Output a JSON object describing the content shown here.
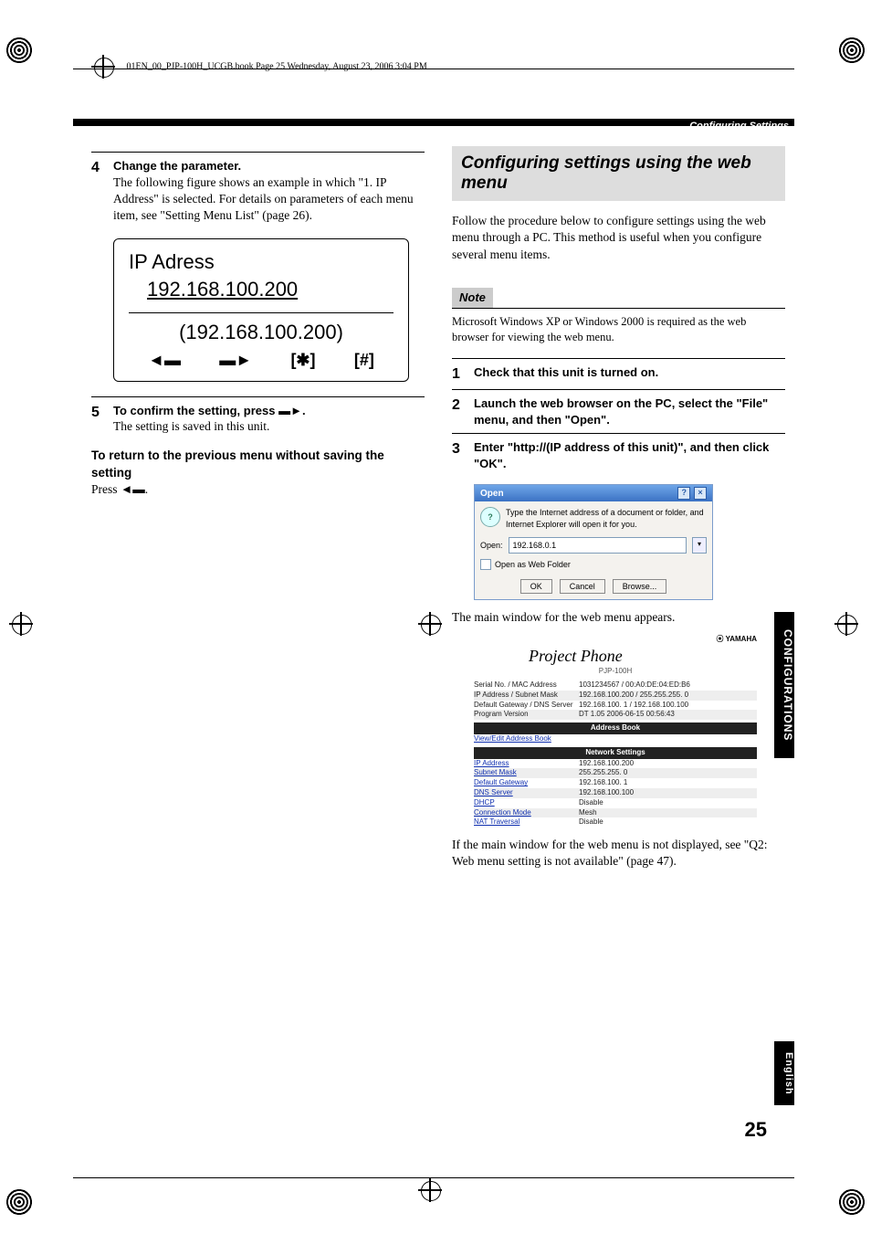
{
  "running_header": "01EN_00_PJP-100H_UCGB.book  Page 25  Wednesday, August 23, 2006  3:04 PM",
  "chapter": "Configuring Settings",
  "left": {
    "step4": {
      "num": "4",
      "title": "Change the parameter.",
      "text": "The following figure shows an example in which \"1. IP Address\" is selected. For details on parameters of each menu item, see \"Setting Menu List\" (page 26).",
      "lcd": {
        "line1": "IP Adress",
        "line2": "192.168.100.200",
        "line3": "(192.168.100.200)",
        "icons": [
          "◄▬",
          "▬►",
          "[✱]",
          "[#]"
        ]
      }
    },
    "step5": {
      "num": "5",
      "title_pre": "To confirm the setting, press ",
      "icon": "▬►",
      "title_post": ".",
      "text": "The setting is saved in this unit."
    },
    "sub1": {
      "heading": "To return to the previous menu without saving the setting",
      "text_pre": "Press ",
      "icon": "◄▬",
      "text_post": "."
    }
  },
  "right": {
    "heading": "Configuring settings using the web menu",
    "intro": "Follow the procedure below to configure settings using the web menu through a PC. This method is useful when you configure several menu items.",
    "note_label": "Note",
    "note_text": "Microsoft Windows XP or Windows 2000 is required as the web browser for viewing the web menu.",
    "step1": {
      "num": "1",
      "title": "Check that this unit is turned on."
    },
    "step2": {
      "num": "2",
      "title": "Launch the web browser on the PC, select the \"File\" menu, and then \"Open\"."
    },
    "step3": {
      "num": "3",
      "title": "Enter \"http://(IP address of this unit)\", and then click \"OK\"."
    },
    "dialog": {
      "title": "Open",
      "help_icon": "?",
      "close_icon": "×",
      "msg": "Type the Internet address of a document or folder, and Internet Explorer will open it for you.",
      "open_label": "Open:",
      "input_value": "192.168.0.1",
      "checkbox_label": "Open as Web Folder",
      "ok": "OK",
      "cancel": "Cancel",
      "browse": "Browse..."
    },
    "after_dialog": "The main window for the web menu appears.",
    "webmenu": {
      "brand": "YAMAHA",
      "logo": "Project Phone",
      "model": "PJP-100H",
      "info": [
        {
          "k": "Serial No. / MAC Address",
          "v": "1031234567 / 00:A0:DE:04:ED:B6"
        },
        {
          "k": "IP Address / Subnet Mask",
          "v": "192.168.100.200 / 255.255.255. 0"
        },
        {
          "k": "Default Gateway / DNS Server",
          "v": "192.168.100. 1 / 192.168.100.100"
        },
        {
          "k": "Program Version",
          "v": "DT 1.05 2006-06-15 00:56:43"
        }
      ],
      "bar1": "Address Book",
      "addrbook": "View/Edit Address Book",
      "bar2": "Network Settings",
      "net": [
        {
          "k": "IP Address",
          "v": "192.168.100.200"
        },
        {
          "k": "Subnet Mask",
          "v": "255.255.255. 0"
        },
        {
          "k": "Default Gateway",
          "v": "192.168.100. 1"
        },
        {
          "k": "DNS Server",
          "v": "192.168.100.100"
        },
        {
          "k": "DHCP",
          "v": "Disable"
        },
        {
          "k": "Connection Mode",
          "v": "Mesh"
        },
        {
          "k": "NAT Traversal",
          "v": "Disable"
        }
      ]
    },
    "after_webmenu": "If the main window for the web menu is not displayed, see \"Q2: Web menu setting is not available\" (page 47)."
  },
  "page_number": "25",
  "side_tab1": "CONFIGURATIONS",
  "side_tab2": "English"
}
